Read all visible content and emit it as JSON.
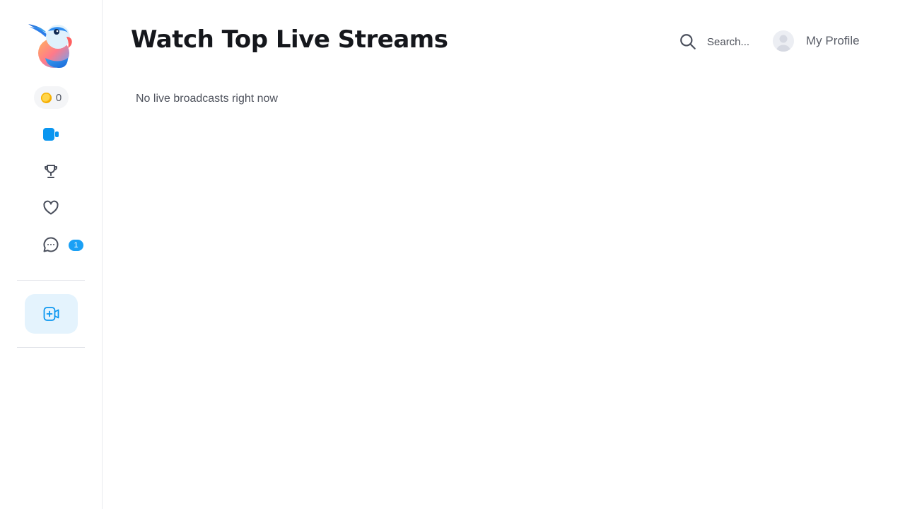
{
  "header": {
    "title": "Watch Top Live Streams",
    "search_placeholder": "Search...",
    "profile_label": "My Profile"
  },
  "sidebar": {
    "coin_count": "0",
    "items": [
      {
        "name": "live-streams",
        "icon": "video-camera-icon",
        "active": true
      },
      {
        "name": "leaderboard",
        "icon": "trophy-icon"
      },
      {
        "name": "favorites",
        "icon": "heart-icon"
      },
      {
        "name": "messages",
        "icon": "chat-bubble-icon",
        "badge": "1"
      }
    ],
    "go_live_icon": "video-add-icon"
  },
  "main": {
    "empty_message": "No live broadcasts right now"
  },
  "colors": {
    "accent": "#0a96f0",
    "badge": "#1aa0f5",
    "go_live_bg": "#e4f3fd",
    "icon": "#4a4f5c"
  }
}
